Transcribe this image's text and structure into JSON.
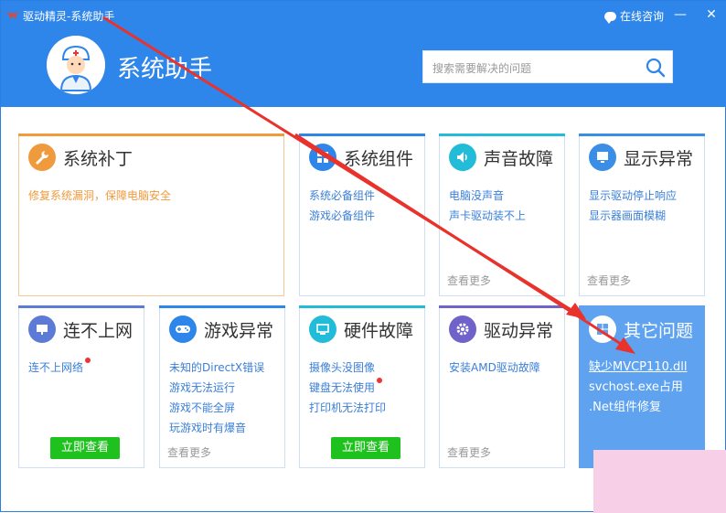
{
  "window": {
    "title": "驱动精灵-系统助手",
    "consult_label": "在线咨询",
    "minimize_symbol": "—",
    "close_symbol": "✕"
  },
  "header": {
    "brand": "系统助手",
    "search_placeholder": "搜索需要解决的问题",
    "colors": {
      "bg": "#2f86ea"
    }
  },
  "cards": [
    {
      "title": "系统补丁",
      "icon": "wrench-icon",
      "accent": "#f09a3e",
      "links": [
        "修复系统漏洞，保障电脑安全"
      ],
      "more": ""
    },
    {
      "title": "系统组件",
      "icon": "components-icon",
      "accent": "#2f86ea",
      "links": [
        "系统必备组件",
        "游戏必备组件"
      ],
      "more": ""
    },
    {
      "title": "声音故障",
      "icon": "speaker-icon",
      "accent": "#22bcd8",
      "links": [
        "电脑没声音",
        "声卡驱动装不上"
      ],
      "more": "查看更多"
    },
    {
      "title": "显示异常",
      "icon": "monitor-icon",
      "accent": "#3a8ee6",
      "links": [
        "显示驱动停止响应",
        "显示器画面模糊"
      ],
      "more": "查看更多"
    },
    {
      "title": "连不上网",
      "icon": "network-icon",
      "accent": "#5b7bd6",
      "links": [
        "连不上网络"
      ],
      "more": "",
      "button": "立即查看"
    },
    {
      "title": "游戏异常",
      "icon": "gamepad-icon",
      "accent": "#2f86ea",
      "links": [
        "未知的DirectX错误",
        "游戏无法运行",
        "游戏不能全屏",
        "玩游戏时有爆音"
      ],
      "more": "查看更多"
    },
    {
      "title": "硬件故障",
      "icon": "hardware-icon",
      "accent": "#22bcd8",
      "links": [
        "摄像头没图像",
        "键盘无法使用",
        "打印机无法打印"
      ],
      "more": "",
      "button": "立即查看"
    },
    {
      "title": "驱动异常",
      "icon": "gear-icon",
      "accent": "#6f63c9",
      "links": [
        "安装AMD驱动故障"
      ],
      "more": "查看更多"
    },
    {
      "title": "其它问题",
      "icon": "windows-icon",
      "accent": "#5fa3f0",
      "links": [
        "缺少MVCP110.dll",
        "svchost.exe占用",
        ".Net组件修复"
      ],
      "more": ""
    }
  ]
}
